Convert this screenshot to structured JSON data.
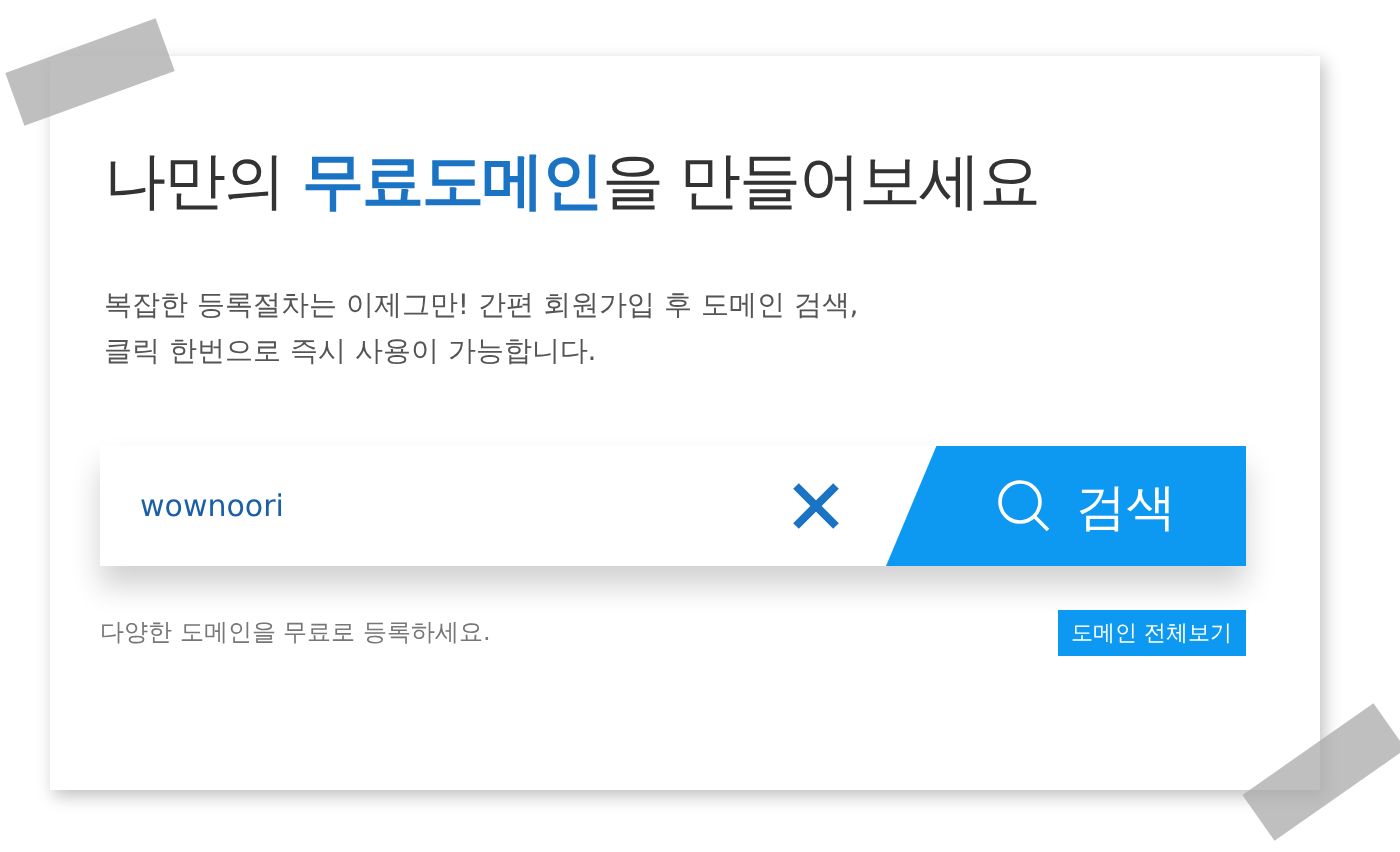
{
  "heading": "나만의 **무료도메인**을 만들어보세요",
  "description": [
    "복잡한 등록절차는 이제그만! 간편 회원가입 후 도메인 검색,",
    "클릭 한번으로 즉시 사용이 가능합니다."
  ],
  "search": {
    "value": "wownoori",
    "button": "검색"
  },
  "note": "다양한 도메인을 무료로 등록하세요.",
  "view_all_button": "도메인 전체보기"
}
